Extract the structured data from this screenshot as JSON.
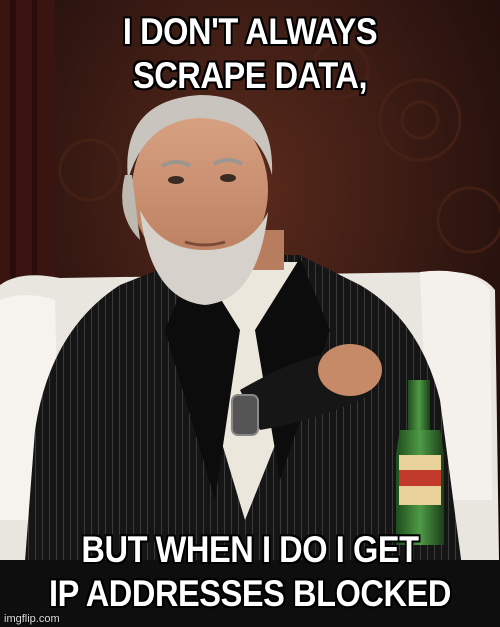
{
  "meme": {
    "top_text": [
      "I DON'T ALWAYS",
      "SCRAPE DATA,"
    ],
    "bottom_text": [
      "BUT WHEN I DO I GET",
      "IP ADDRESSES BLOCKED"
    ],
    "watermark": "imgflip.com"
  },
  "colors": {
    "background": "#2a1410",
    "caption_fill": "#ffffff",
    "caption_stroke": "#000000",
    "jacket": "#141414",
    "shirt": "#e8e2d6",
    "bottle": "#2f6b2a"
  }
}
